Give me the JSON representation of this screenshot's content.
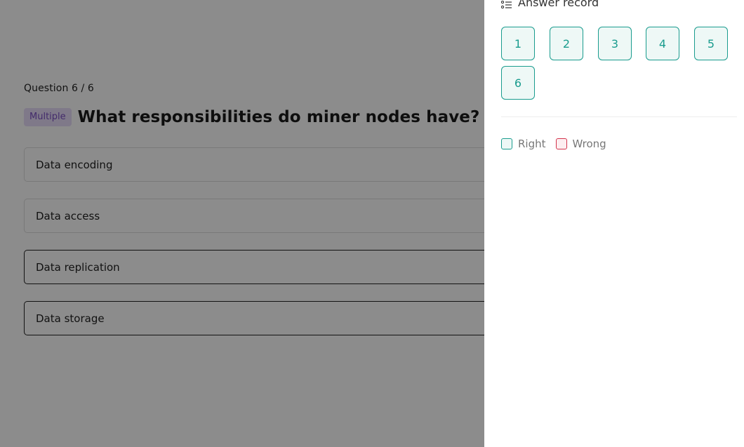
{
  "question": {
    "counter": "Question 6 / 6",
    "type_badge": "Multiple",
    "title": "What responsibilities do miner nodes have?",
    "options": [
      {
        "label": "Data encoding",
        "selected": false
      },
      {
        "label": "Data access",
        "selected": false
      },
      {
        "label": "Data replication",
        "selected": true
      },
      {
        "label": "Data storage",
        "selected": true
      }
    ]
  },
  "drawer": {
    "title": "Answer record",
    "icon": "list-icon",
    "numbers": [
      "1",
      "2",
      "3",
      "4",
      "5",
      "6"
    ],
    "legend": {
      "right_label": "Right",
      "wrong_label": "Wrong"
    }
  },
  "colors": {
    "accent": "#1a9c8e",
    "wrong": "#d3344c",
    "badge_bg": "#e8dcfa",
    "badge_text": "#7a4fc4"
  }
}
